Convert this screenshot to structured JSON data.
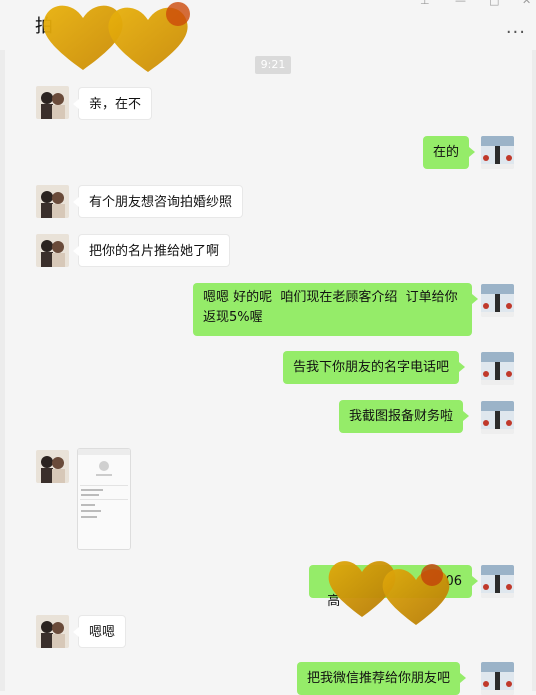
{
  "window": {
    "title": "拍",
    "pin_icon": "pin-icon",
    "minimize_icon": "minimize-icon",
    "maximize_icon": "maximize-icon",
    "close_icon": "close-icon",
    "more_label": "···"
  },
  "chat": {
    "timestamp": "9:21",
    "messages": [
      {
        "side": "in",
        "text": "亲，在不"
      },
      {
        "side": "out",
        "text": "在的"
      },
      {
        "side": "in",
        "text": "有个朋友想咨询拍婚纱照"
      },
      {
        "side": "in",
        "text": "把你的名片推给她了啊"
      },
      {
        "side": "out",
        "text": "嗯嗯 好的呢  咱们现在老顾客介绍  订单给你返现5%喔"
      },
      {
        "side": "out",
        "text": "告我下你朋友的名字电话吧"
      },
      {
        "side": "out",
        "text": "我截图报备财务啦"
      },
      {
        "side": "in",
        "type": "image",
        "text": ""
      },
      {
        "side": "out",
        "text": "高"
      },
      {
        "side": "out",
        "text": "06"
      },
      {
        "side": "in",
        "text": "嗯嗯"
      },
      {
        "side": "out",
        "text": "把我微信推荐给你朋友吧"
      }
    ]
  },
  "colors": {
    "outgoing_bubble": "#95ec69",
    "incoming_bubble": "#ffffff",
    "background": "#f5f5f5",
    "heart_gold": "#d4a017",
    "heart_orange": "#cc6a0a"
  }
}
